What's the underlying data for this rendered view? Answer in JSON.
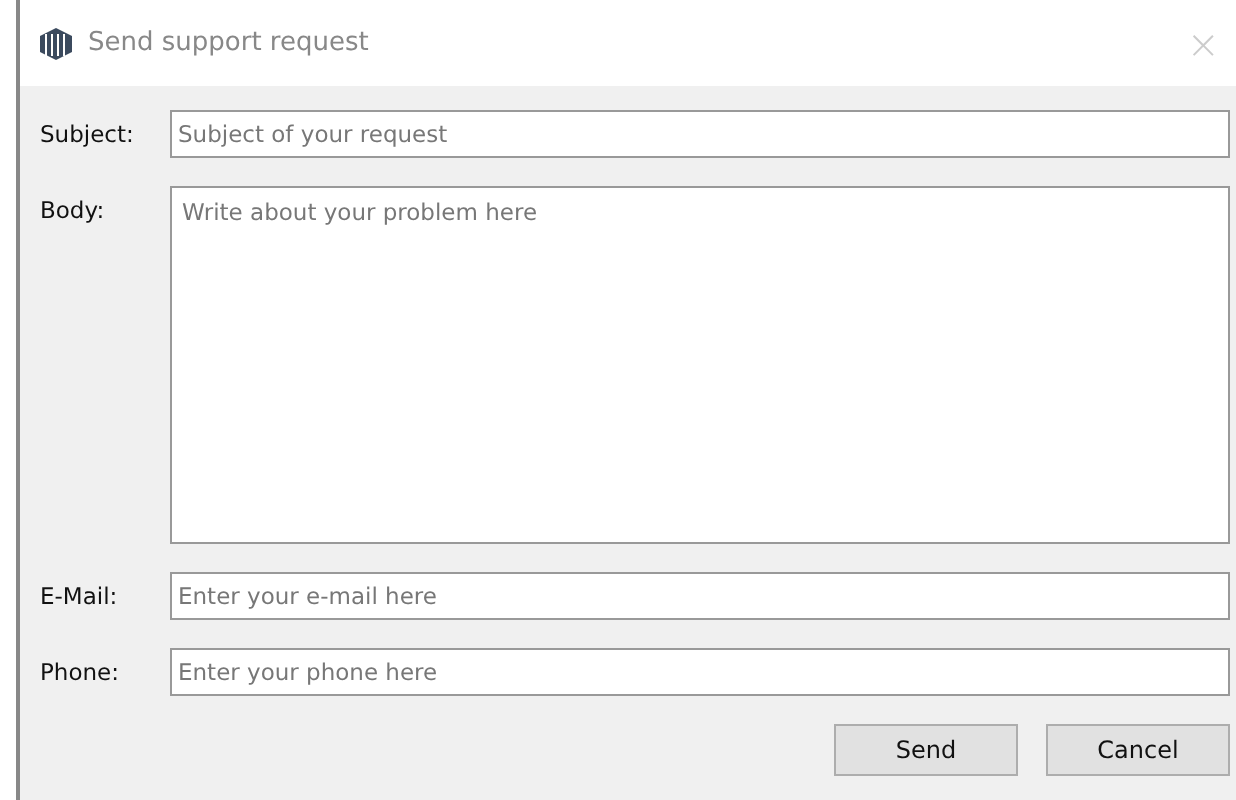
{
  "window": {
    "title": "Send support request",
    "close": "×"
  },
  "fields": [
    {
      "label": "Subject:",
      "kind": "line",
      "placeholder": "Subject of your request"
    },
    {
      "label": "Body:",
      "kind": "multiline",
      "placeholder": "Write about your problem here"
    },
    {
      "label": "E-Mail:",
      "kind": "line",
      "placeholder": "Enter your e-mail here"
    },
    {
      "label": "Phone:",
      "kind": "line",
      "placeholder": "Enter your phone here"
    }
  ],
  "buttons": [
    "Send",
    "Cancel"
  ]
}
